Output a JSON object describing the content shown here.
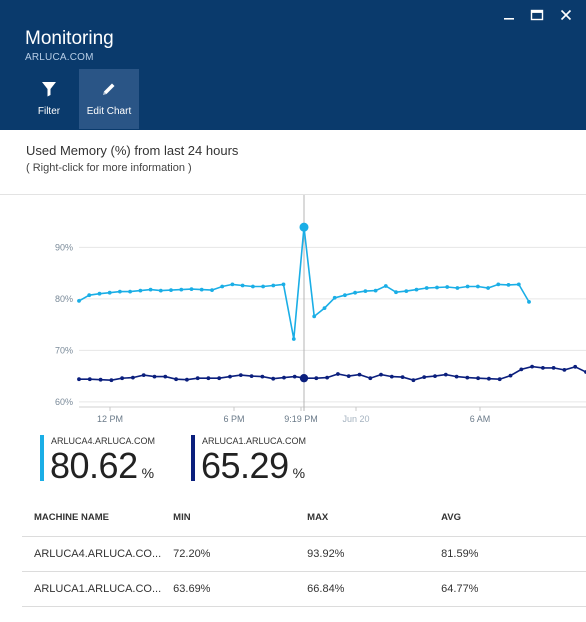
{
  "blade": {
    "title": "Monitoring",
    "subtitle": "ARLUCA.COM"
  },
  "window_controls": [
    {
      "name": "minimize-button",
      "icon": "minimize-icon"
    },
    {
      "name": "maximize-button",
      "icon": "maximize-icon"
    },
    {
      "name": "close-button",
      "icon": "close-icon"
    }
  ],
  "commands": {
    "filter_label": "Filter",
    "edit_chart_label": "Edit Chart"
  },
  "chart_header": {
    "title": "Used Memory (%) from last 24 hours",
    "hint": "( Right-click for more information )"
  },
  "colors": {
    "header_bg": "#0a3a6c",
    "active_cmd": "#2a5586",
    "series_light": "#1aaee6",
    "series_dark": "#0b1f7d"
  },
  "chart_data": {
    "type": "line",
    "title": "Used Memory (%) from last 24 hours",
    "ylim": [
      59,
      99
    ],
    "yticks": [
      60,
      70,
      80,
      90
    ],
    "ytick_labels": [
      "60%",
      "70%",
      "80%",
      "90%"
    ],
    "x_tick_labels": [
      "12 PM",
      "6 PM",
      "9:19 PM",
      "Jun 20",
      "6 AM"
    ],
    "grid": true,
    "cursor_label": "9:19 PM",
    "series": [
      {
        "name": "ARLUCA4.ARLUCA.COM",
        "color": "#1aaee6",
        "values": [
          79.6,
          80.7,
          81.0,
          81.2,
          81.4,
          81.4,
          81.6,
          81.8,
          81.6,
          81.7,
          81.8,
          81.9,
          81.8,
          81.7,
          82.4,
          82.8,
          82.6,
          82.4,
          82.4,
          82.6,
          82.8,
          72.2,
          93.92,
          76.6,
          78.2,
          80.2,
          80.7,
          81.2,
          81.5,
          81.6,
          82.5,
          81.3,
          81.5,
          81.8,
          82.1,
          82.2,
          82.3,
          82.1,
          82.4,
          82.4,
          82.1,
          82.8,
          82.7,
          82.8,
          79.4
        ],
        "current": "80.62",
        "unit": "%"
      },
      {
        "name": "ARLUCA1.ARLUCA.COM",
        "color": "#0b1f7d",
        "values": [
          64.4,
          64.4,
          64.3,
          64.2,
          64.6,
          64.7,
          65.2,
          64.9,
          64.9,
          64.4,
          64.3,
          64.6,
          64.6,
          64.6,
          64.9,
          65.2,
          65.0,
          64.9,
          64.5,
          64.7,
          64.9,
          64.6,
          64.6,
          64.7,
          65.4,
          65.0,
          65.3,
          64.6,
          65.3,
          64.9,
          64.8,
          64.2,
          64.8,
          65.0,
          65.3,
          64.9,
          64.7,
          64.6,
          64.5,
          64.4,
          65.1,
          66.3,
          66.84,
          66.6,
          66.6,
          66.2,
          66.8,
          65.8
        ],
        "current": "65.29",
        "unit": "%"
      }
    ]
  },
  "table": {
    "headers": [
      "MACHINE NAME",
      "MIN",
      "MAX",
      "AVG"
    ],
    "rows": [
      [
        "ARLUCA4.ARLUCA.CO...",
        "72.20%",
        "93.92%",
        "81.59%"
      ],
      [
        "ARLUCA1.ARLUCA.CO...",
        "63.69%",
        "66.84%",
        "64.77%"
      ]
    ]
  }
}
